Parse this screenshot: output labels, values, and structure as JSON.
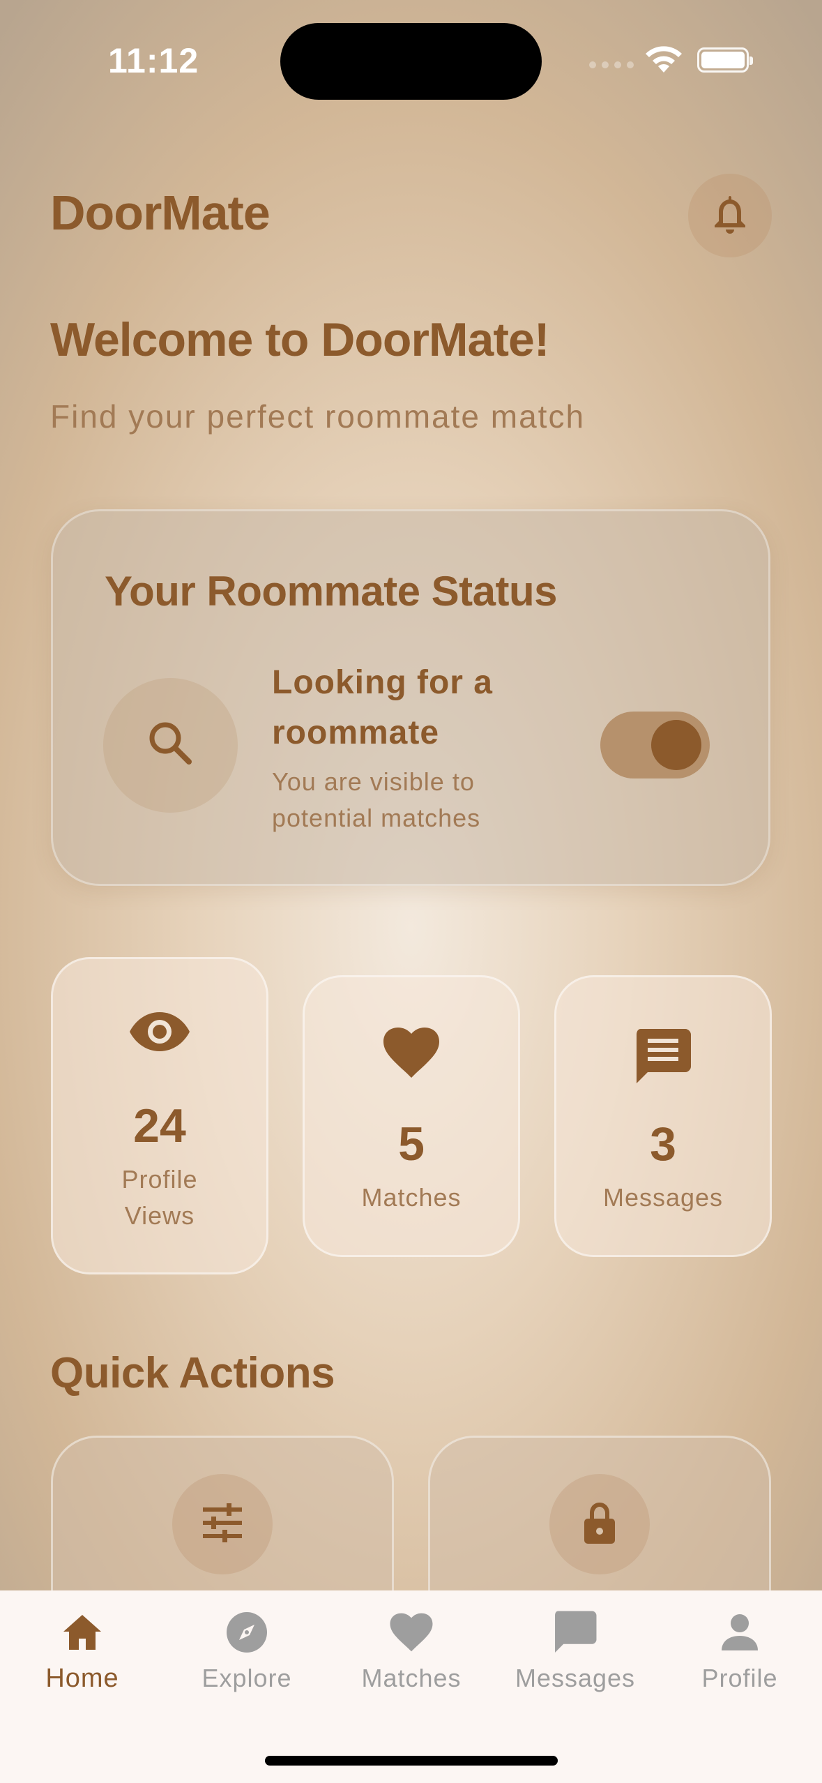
{
  "status_bar": {
    "time": "11:12"
  },
  "header": {
    "brand": "DoorMate"
  },
  "welcome": {
    "title": "Welcome to DoorMate!",
    "subtitle": "Find your perfect roommate match"
  },
  "status_card": {
    "title": "Your Roommate Status",
    "heading": "Looking for a roommate",
    "description": "You are visible to potential matches",
    "toggle_on": true
  },
  "stats": [
    {
      "icon": "eye-icon",
      "value": "24",
      "label": "Profile Views"
    },
    {
      "icon": "heart-icon",
      "value": "5",
      "label": "Matches"
    },
    {
      "icon": "message-icon",
      "value": "3",
      "label": "Messages"
    }
  ],
  "quick_actions": {
    "title": "Quick Actions",
    "items": [
      {
        "icon": "sliders-icon"
      },
      {
        "icon": "lock-icon"
      }
    ]
  },
  "tabs": [
    {
      "label": "Home",
      "icon": "home-icon",
      "active": true
    },
    {
      "label": "Explore",
      "icon": "compass-icon",
      "active": false
    },
    {
      "label": "Matches",
      "icon": "heart-icon",
      "active": false
    },
    {
      "label": "Messages",
      "icon": "message-icon",
      "active": false
    },
    {
      "label": "Profile",
      "icon": "person-icon",
      "active": false
    }
  ],
  "colors": {
    "accent": "#8c5a2c",
    "muted": "#a27a55",
    "tab_inactive": "#9e9e9e",
    "tabbar_bg": "#fcf6f3"
  }
}
